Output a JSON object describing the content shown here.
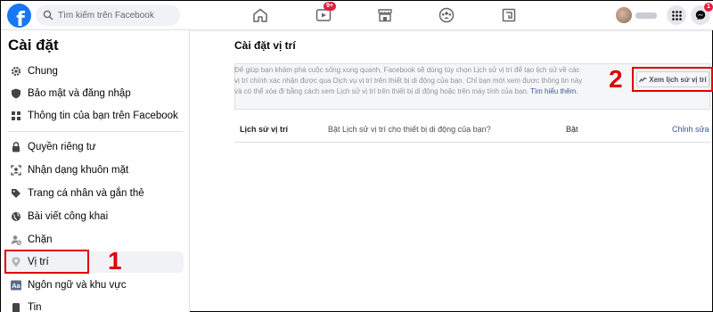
{
  "topbar": {
    "logo": "f",
    "search_placeholder": "Tìm kiếm trên Facebook",
    "video_badge": "9+",
    "messenger_badge": "1",
    "icons": [
      "home-icon",
      "watch-icon",
      "marketplace-icon",
      "groups-icon",
      "gaming-icon",
      "menu-grid-icon",
      "messenger-icon"
    ]
  },
  "sidebar": {
    "title": "Cài đặt",
    "items": [
      {
        "label": "Chung",
        "icon": "gear-icon"
      },
      {
        "label": "Bảo mật và đăng nhập",
        "icon": "shield-icon"
      },
      {
        "label": "Thông tin của bạn trên Facebook",
        "icon": "facebook-square-icon"
      },
      {
        "label": "Quyền riêng tư",
        "icon": "lock-icon"
      },
      {
        "label": "Nhận dạng khuôn mặt",
        "icon": "face-id-icon"
      },
      {
        "label": "Trang cá nhân và gắn thẻ",
        "icon": "tag-icon"
      },
      {
        "label": "Bài viết công khai",
        "icon": "globe-icon"
      },
      {
        "label": "Chặn",
        "icon": "block-user-icon"
      },
      {
        "label": "Vị trí",
        "icon": "location-pin-icon"
      },
      {
        "label": "Ngôn ngữ và khu vực",
        "icon": "language-icon"
      },
      {
        "label": "Tin",
        "icon": "story-icon"
      }
    ],
    "active_index": 8
  },
  "main": {
    "title": "Cài đặt vị trí",
    "info_text": "Để giúp bạn khám phá cuộc sống xung quanh, Facebook sẽ dùng tùy chọn Lịch sử vị trí để tạo lịch sử về các vị trí chính xác nhận được qua Dịch vụ vị trí trên thiết bị di động của bạn. Chỉ bạn mới xem được thông tin này và có thể xóa đi bằng cách xem Lịch sử vị trí trên thiết bị di động hoặc trên máy tính của bạn.",
    "learn_more": "Tìm hiểu thêm.",
    "history_button": "Xem lịch sử vị trí",
    "setting": {
      "label": "Lịch sử vị trí",
      "question": "Bật Lịch sử vị trí cho thiết bị di động của bạn?",
      "status": "Bật",
      "edit": "Chỉnh sửa"
    }
  },
  "annotations": {
    "step1": "1",
    "step2": "2",
    "color": "#e00000"
  },
  "colors": {
    "facebook_blue": "#1877f2",
    "link_blue": "#385898",
    "badge_red": "#e41e3f"
  }
}
